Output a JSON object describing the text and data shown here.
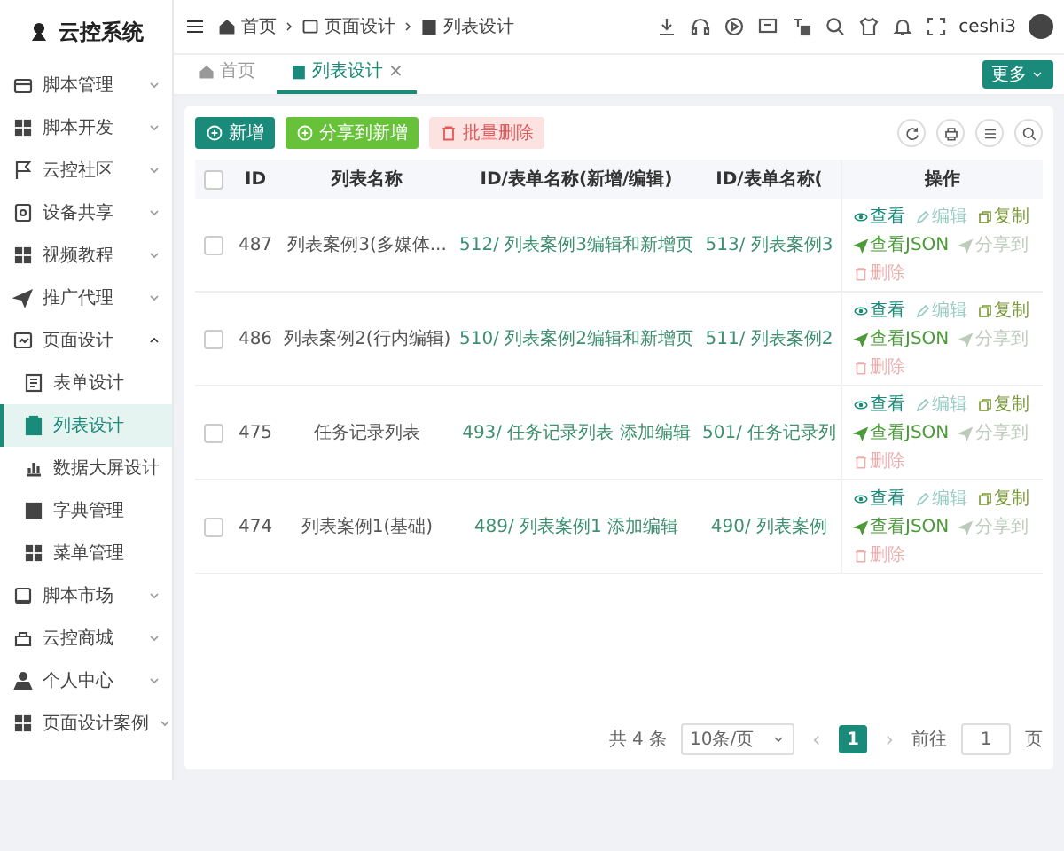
{
  "sidebar": {
    "title": "云控系统",
    "items": [
      {
        "label": "脚本管理",
        "expanded": false
      },
      {
        "label": "脚本开发",
        "expanded": false
      },
      {
        "label": "云控社区",
        "expanded": false
      },
      {
        "label": "设备共享",
        "expanded": false
      },
      {
        "label": "视频教程",
        "expanded": false
      },
      {
        "label": "推广代理",
        "expanded": false
      },
      {
        "label": "页面设计",
        "expanded": true,
        "children": [
          {
            "label": "表单设计",
            "selected": false
          },
          {
            "label": "列表设计",
            "selected": true
          },
          {
            "label": "数据大屏设计",
            "selected": false
          },
          {
            "label": "字典管理",
            "selected": false
          },
          {
            "label": "菜单管理",
            "selected": false
          }
        ]
      },
      {
        "label": "脚本市场",
        "expanded": false
      },
      {
        "label": "云控商城",
        "expanded": false
      },
      {
        "label": "个人中心",
        "expanded": false
      },
      {
        "label": "页面设计案例",
        "expanded": false
      }
    ]
  },
  "header": {
    "breadcrumb": [
      "首页",
      "页面设计",
      "列表设计"
    ],
    "user": "ceshi3"
  },
  "tabs": [
    {
      "label": "首页",
      "selected": false
    },
    {
      "label": "列表设计",
      "selected": true,
      "close": "×"
    }
  ],
  "more_button": "更多",
  "toolbar": [
    {
      "label": "新增",
      "kind": "primary",
      "disabled": false
    },
    {
      "label": "分享到新增",
      "kind": "success",
      "disabled": false
    },
    {
      "label": "批量删除",
      "kind": "danger",
      "disabled": true
    }
  ],
  "table": {
    "header_checked": false,
    "columns": [
      "ID",
      "列表名称",
      "ID/表单名称(新增/编辑)",
      "ID/表单名称(",
      "操作"
    ],
    "rows": [
      {
        "checked": false,
        "cells": [
          "487",
          "列表案例3(多媒体...",
          "512/ 列表案例3编辑和新增页",
          "513/ 列表案例3"
        ],
        "actions": [
          {
            "label": "查看",
            "kind": "view",
            "disabled": false
          },
          {
            "label": "编辑",
            "kind": "edit",
            "disabled": true
          },
          {
            "label": "复制",
            "kind": "copy",
            "disabled": false
          },
          {
            "label": "查看JSON",
            "kind": "json",
            "disabled": false
          },
          {
            "label": "分享到",
            "kind": "share",
            "disabled": true
          },
          {
            "label": "删除",
            "kind": "delete",
            "disabled": true
          }
        ]
      },
      {
        "checked": false,
        "cells": [
          "486",
          "列表案例2(行内编辑)",
          "510/ 列表案例2编辑和新增页",
          "511/ 列表案例2"
        ],
        "actions": [
          {
            "label": "查看",
            "kind": "view",
            "disabled": false
          },
          {
            "label": "编辑",
            "kind": "edit",
            "disabled": true
          },
          {
            "label": "复制",
            "kind": "copy",
            "disabled": false
          },
          {
            "label": "查看JSON",
            "kind": "json",
            "disabled": false
          },
          {
            "label": "分享到",
            "kind": "share",
            "disabled": true
          },
          {
            "label": "删除",
            "kind": "delete",
            "disabled": true
          }
        ]
      },
      {
        "checked": false,
        "cells": [
          "475",
          "任务记录列表",
          "493/ 任务记录列表 添加编辑",
          "501/ 任务记录列"
        ],
        "actions": [
          {
            "label": "查看",
            "kind": "view",
            "disabled": false
          },
          {
            "label": "编辑",
            "kind": "edit",
            "disabled": true
          },
          {
            "label": "复制",
            "kind": "copy",
            "disabled": false
          },
          {
            "label": "查看JSON",
            "kind": "json",
            "disabled": false
          },
          {
            "label": "分享到",
            "kind": "share",
            "disabled": true
          },
          {
            "label": "删除",
            "kind": "delete",
            "disabled": true
          }
        ]
      },
      {
        "checked": false,
        "cells": [
          "474",
          "列表案例1(基础)",
          "489/ 列表案例1 添加编辑",
          "490/ 列表案例"
        ],
        "actions": [
          {
            "label": "查看",
            "kind": "view",
            "disabled": false
          },
          {
            "label": "编辑",
            "kind": "edit",
            "disabled": true
          },
          {
            "label": "复制",
            "kind": "copy",
            "disabled": false
          },
          {
            "label": "查看JSON",
            "kind": "json",
            "disabled": false
          },
          {
            "label": "分享到",
            "kind": "share",
            "disabled": true
          },
          {
            "label": "删除",
            "kind": "delete",
            "disabled": true
          }
        ]
      }
    ]
  },
  "pagination": {
    "total": "共 4 条",
    "page_size": "10条/页",
    "pages": [
      {
        "label": "1",
        "selected": true
      }
    ],
    "goto_label": "前往",
    "goto_value": "1",
    "goto_suffix": "页"
  }
}
